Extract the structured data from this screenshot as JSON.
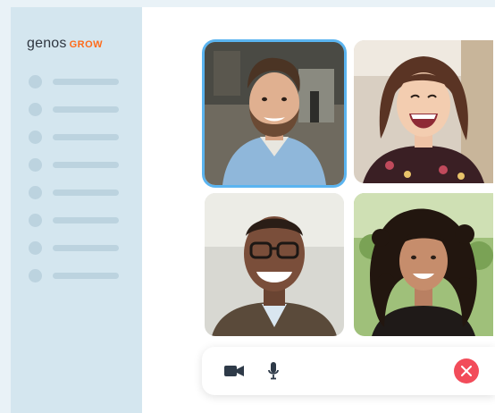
{
  "brand": {
    "name_part1": "genos",
    "name_part2": "GROW"
  },
  "sidebar": {
    "item_count": 8
  },
  "call": {
    "participants": [
      {
        "icon": "participant-video-man-beard",
        "active": true
      },
      {
        "icon": "participant-video-woman-laughing",
        "active": false
      },
      {
        "icon": "participant-video-man-glasses",
        "active": false
      },
      {
        "icon": "participant-video-woman-curly-hair",
        "active": false
      }
    ]
  },
  "controls": {
    "camera_icon": "video-camera-icon",
    "mic_icon": "microphone-icon",
    "end_icon": "end-call-icon"
  },
  "colors": {
    "accent": "#5ab4f0",
    "brand_orange": "#ff6b1a",
    "end_call": "#f24c5a",
    "sidebar": "#d4e6ef"
  }
}
